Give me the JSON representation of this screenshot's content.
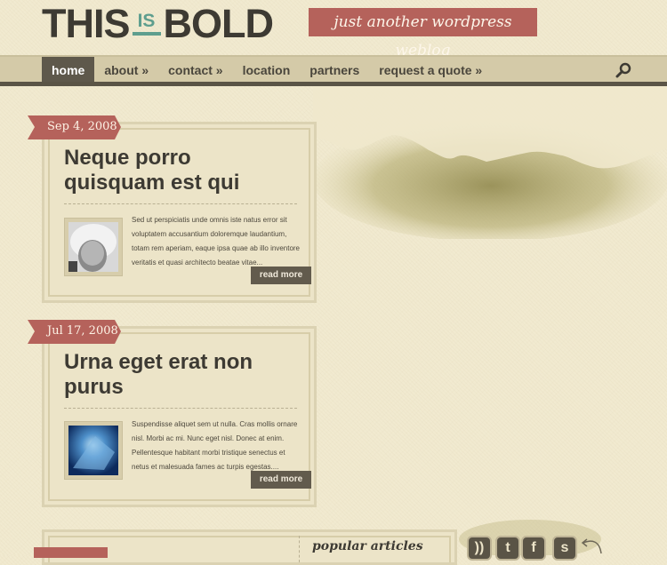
{
  "header": {
    "logo_part1": "THIS",
    "logo_part2": "IS",
    "logo_part3": "BOLD",
    "tagline": "just another wordpress weblog"
  },
  "nav": {
    "items": [
      {
        "label": "home",
        "active": true
      },
      {
        "label": "about »"
      },
      {
        "label": "contact »"
      },
      {
        "label": "location"
      },
      {
        "label": "partners"
      },
      {
        "label": "request a quote »"
      }
    ],
    "search_icon": "search-icon"
  },
  "posts": [
    {
      "date": "Sep 4, 2008",
      "title": "Neque porro quisquam est qui",
      "excerpt": "Sed ut perspiciatis unde omnis iste natus error sit voluptatem accusantium doloremque laudantium, totam rem aperiam, eaque ipsa quae ab illo inventore veritatis et quasi architecto beatae vitae...",
      "thumbnail": "girl-in-hat-photo",
      "read_more": "read more"
    },
    {
      "date": "Jul 17, 2008",
      "title": "Urna eget erat non purus",
      "excerpt": "Suspendisse aliquet sem ut nulla. Cras mollis ornare nisl. Morbi ac mi. Nunc eget nisl. Donec at enim. Pellentesque habitant morbi tristique senectus et netus et malesuada fames ac turpis egestas....",
      "thumbnail": "blue-abstract-photo",
      "read_more": "read more"
    }
  ],
  "sidebar": {
    "popular_heading": "popular articles",
    "social_icons": [
      "rss-icon",
      "twitter-icon",
      "facebook-icon",
      "stumbleupon-icon"
    ]
  },
  "colors": {
    "accent_red": "#b5625b",
    "accent_teal": "#5e9e8e",
    "dark": "#5e584b",
    "background": "#f1ead0"
  }
}
